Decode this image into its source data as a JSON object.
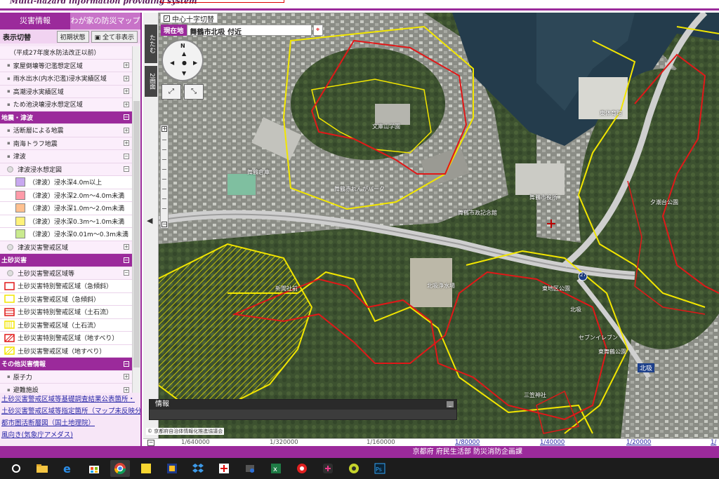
{
  "header": {
    "title": "Multi-hazard information providing system"
  },
  "sidebar": {
    "tabs": [
      {
        "label": "災害情報"
      },
      {
        "label": "わが家の防災マップ"
      }
    ],
    "toolbar": {
      "label": "表示切替",
      "reset": "初期状態",
      "hide_all": "全て非表示"
    },
    "rows": [
      {
        "kind": "plain",
        "label": "（平成27年度水防法改正以前）"
      },
      {
        "kind": "item",
        "label": "家屋倒壊等氾濫想定区域",
        "toggle": "+"
      },
      {
        "kind": "item",
        "label": "雨水出水(内水氾濫)浸水実績区域",
        "toggle": "+"
      },
      {
        "kind": "item",
        "label": "高潮浸水実績区域",
        "toggle": "+"
      },
      {
        "kind": "item",
        "label": "ため池決壊浸水想定区域",
        "toggle": "+"
      },
      {
        "kind": "section",
        "label": "地震・津波",
        "toggle": "−"
      },
      {
        "kind": "item",
        "label": "活断層による地震",
        "toggle": "+"
      },
      {
        "kind": "item",
        "label": "南海トラフ地震",
        "toggle": "+"
      },
      {
        "kind": "item",
        "label": "津波",
        "toggle": "−"
      },
      {
        "kind": "radio",
        "label": "津波浸水想定図",
        "toggle": "−"
      },
      {
        "kind": "swatch",
        "label": "（津波）浸水深4.0m以上",
        "color": "#c8a8f0"
      },
      {
        "kind": "swatch",
        "label": "（津波）浸水深2.0m～4.0m未満",
        "color": "#ff9ba8"
      },
      {
        "kind": "swatch",
        "label": "（津波）浸水深1.0m～2.0m未満",
        "color": "#ffc090"
      },
      {
        "kind": "swatch",
        "label": "（津波）浸水深0.3m～1.0m未満",
        "color": "#fff27a"
      },
      {
        "kind": "swatch",
        "label": "（津波）浸水深0.01m～0.3m未満",
        "color": "#c9ea8e"
      },
      {
        "kind": "radio",
        "label": "津波災害警戒区域",
        "toggle": "+"
      },
      {
        "kind": "section",
        "label": "土砂災害",
        "toggle": "−"
      },
      {
        "kind": "radio",
        "label": "土砂災害警戒区域等",
        "toggle": "−"
      },
      {
        "kind": "legend",
        "label": "土砂災害特別警戒区域（急傾斜）",
        "style": "red-outline"
      },
      {
        "kind": "legend",
        "label": "土砂災害警戒区域（急傾斜）",
        "style": "yellow-outline"
      },
      {
        "kind": "legend",
        "label": "土砂災害特別警戒区域（土石流）",
        "style": "red-lines"
      },
      {
        "kind": "legend",
        "label": "土砂災害警戒区域（土石流）",
        "style": "yellow-lines"
      },
      {
        "kind": "legend",
        "label": "土砂災害特別警戒区域（地すべり）",
        "style": "red-hatch"
      },
      {
        "kind": "legend",
        "label": "土砂災害警戒区域（地すべり）",
        "style": "yellow-hatch"
      },
      {
        "kind": "section",
        "label": "その他災害情報",
        "toggle": "−"
      },
      {
        "kind": "item",
        "label": "原子力",
        "toggle": "+"
      },
      {
        "kind": "item",
        "label": "避難施設",
        "toggle": "+"
      }
    ],
    "links": [
      "土砂災害警戒区域等基礎調査結果公表箇所・",
      "土砂災害警戒区域等指定箇所（マップ未反映分）",
      "都市圏活断層図（国土地理院）",
      "風向き(気象庁アメダス)"
    ]
  },
  "map": {
    "crosshair_toggle": "中心十字切替",
    "current_location_label": "現在地",
    "current_location": "舞鶴市北吸 付近",
    "fold_button": "たたむ",
    "two_screen_button": "2画面",
    "compass": {
      "n": "N"
    },
    "info_panel_title": "情報",
    "copyright": "© 京都府自治体情報化推進協議会",
    "labels": [
      "文庫山学園",
      "舞鶴市役所",
      "舞鶴市政記念館",
      "舞鶴赤れんがパーク",
      "北吸",
      "夕潮台公園",
      "セブンイレブン",
      "東体育館",
      "舞鶴倉庫",
      "三笠神社",
      "北吸浄水場",
      "東舞鶴公園",
      "東地区公園",
      "新聞社前"
    ],
    "route_label": "27"
  },
  "scales": [
    {
      "label": "1/640000",
      "active": false
    },
    {
      "label": "1/320000",
      "active": false
    },
    {
      "label": "1/160000",
      "active": false
    },
    {
      "label": "1/80000",
      "active": true
    },
    {
      "label": "1/40000",
      "active": true
    },
    {
      "label": "1/20000",
      "active": true
    },
    {
      "label": "1/",
      "active": true
    }
  ],
  "footer": {
    "text": "京都府 府民生活部 防災消防企画課"
  },
  "taskbar": {
    "icons": [
      "cortana-icon",
      "file-explorer-icon",
      "edge-icon",
      "store-icon",
      "chrome-icon",
      "sticky-notes-icon",
      "app-icon",
      "dropbox-icon",
      "app2-icon",
      "app3-icon",
      "excel-like-icon",
      "app4-icon",
      "app5-icon",
      "app6-icon",
      "photoshop-icon"
    ]
  },
  "colors": {
    "accent": "#9b2a9b",
    "red_zone": "#e01818",
    "yellow_zone": "#f2e600"
  }
}
